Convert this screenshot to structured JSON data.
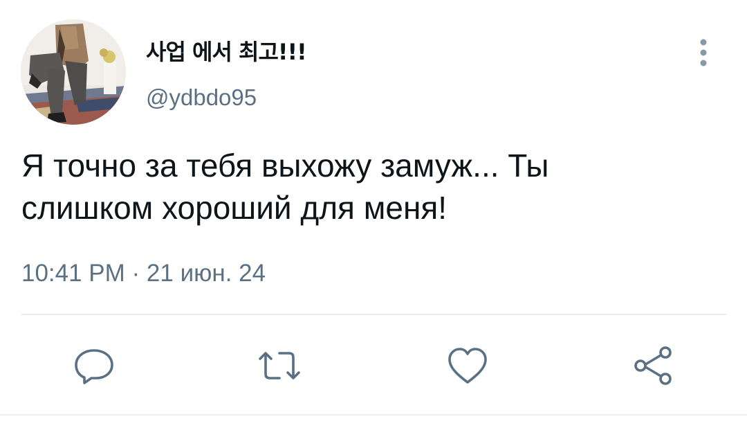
{
  "user": {
    "display_name": "사업 에서 최고!!!",
    "handle": "@ydbdo95",
    "avatar_icon": "profile-photo"
  },
  "tweet": {
    "text_line1": "Я точно за тебя выхожу замуж... Ты",
    "text_line2": "слишком хороший для меня!",
    "timestamp": "10:41 PM · 21 июн. 24"
  },
  "actions": {
    "reply_icon": "reply-icon",
    "retweet_icon": "retweet-icon",
    "like_icon": "heart-icon",
    "share_icon": "share-icon"
  },
  "colors": {
    "text_primary": "#0f1419",
    "text_secondary": "#5b7083",
    "divider": "#e6ecf0",
    "icon": "#5b7083"
  }
}
